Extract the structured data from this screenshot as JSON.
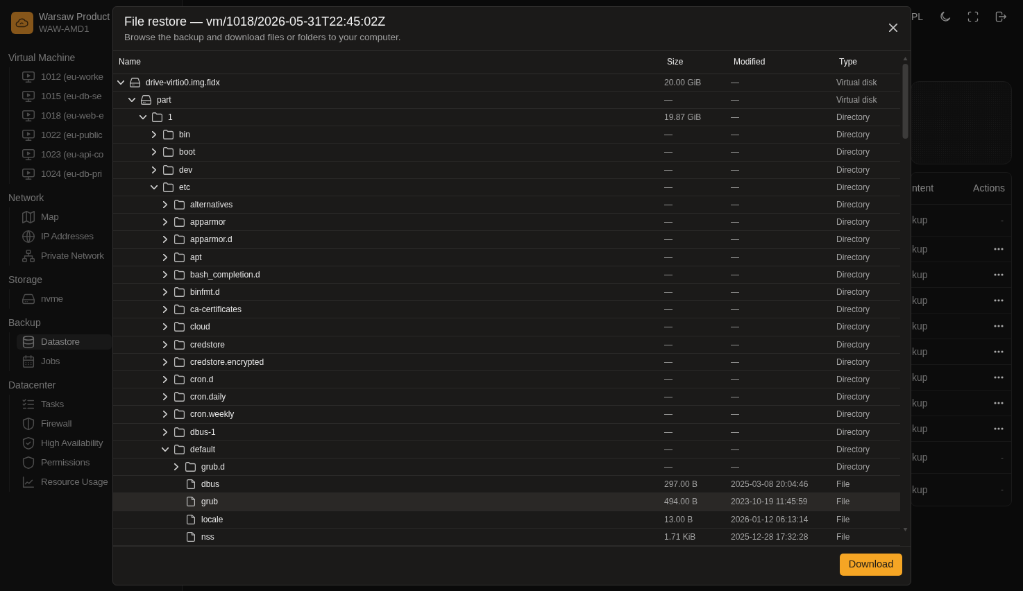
{
  "sidebar": {
    "brand": {
      "name": "Warsaw Product",
      "host": "WAW-AMD1"
    },
    "sections": [
      {
        "title": "Virtual Machine",
        "items": [
          {
            "label": "1012 (eu-worke",
            "selected": false
          },
          {
            "label": "1015 (eu-db-se",
            "selected": false
          },
          {
            "label": "1018 (eu-web-e",
            "selected": false
          },
          {
            "label": "1022 (eu-public",
            "selected": false
          },
          {
            "label": "1023 (eu-api-co",
            "selected": false
          },
          {
            "label": "1024 (eu-db-pri",
            "selected": false
          }
        ]
      },
      {
        "title": "Network",
        "items": [
          {
            "label": "Map",
            "selected": false
          },
          {
            "label": "IP Addresses",
            "selected": false
          },
          {
            "label": "Private Network",
            "selected": false
          }
        ]
      },
      {
        "title": "Storage",
        "items": [
          {
            "label": "nvme",
            "selected": false
          }
        ]
      },
      {
        "title": "Backup",
        "items": [
          {
            "label": "Datastore",
            "selected": true
          },
          {
            "label": "Jobs",
            "selected": false
          }
        ]
      },
      {
        "title": "Datacenter",
        "items": [
          {
            "label": "Tasks",
            "selected": false
          },
          {
            "label": "Firewall",
            "selected": false
          },
          {
            "label": "High Availability",
            "selected": false
          },
          {
            "label": "Permissions",
            "selected": false
          },
          {
            "label": "Resource Usage",
            "selected": false
          }
        ]
      }
    ]
  },
  "topbar": {
    "language": "PL"
  },
  "backups": {
    "columns": [
      "ntent",
      "Actions"
    ],
    "rows": [
      {
        "column_1": "kup",
        "kind": "text",
        "actions": "-"
      },
      {
        "column_1": "kup",
        "kind": "menu"
      },
      {
        "column_1": "kup",
        "kind": "menu"
      },
      {
        "column_1": "kup",
        "kind": "menu"
      },
      {
        "column_1": "kup",
        "kind": "menu"
      },
      {
        "column_1": "kup",
        "kind": "menu"
      },
      {
        "column_1": "kup",
        "kind": "menu"
      },
      {
        "column_1": "kup",
        "kind": "menu"
      },
      {
        "column_1": "kup",
        "kind": "menu"
      },
      {
        "column_1": "kup",
        "kind": "text",
        "actions": "-"
      },
      {
        "column_1": "kup",
        "kind": "text",
        "actions": "-"
      }
    ]
  },
  "dialog": {
    "title": "File restore — vm/1018/2026-05-31T22:45:02Z",
    "subtitle": "Browse the backup and download files or folders to your computer.",
    "columns": [
      "Name",
      "Size",
      "Modified",
      "Type"
    ],
    "tree": [
      {
        "name": "drive-virtio0.img.fidx",
        "kind": "disk",
        "expanded": true,
        "selected": false,
        "size": "20.00 GiB",
        "modified": "—",
        "type": "Virtual disk",
        "children": [
          {
            "name": "part",
            "kind": "disk",
            "expanded": true,
            "selected": false,
            "size": "—",
            "modified": "—",
            "type": "Virtual disk",
            "children": [
              {
                "name": "1",
                "kind": "folder",
                "expanded": true,
                "selected": false,
                "size": "19.87 GiB",
                "modified": "—",
                "type": "Directory",
                "children": [
                  {
                    "name": "bin",
                    "kind": "folder",
                    "expanded": false,
                    "selected": false,
                    "size": "—",
                    "modified": "—",
                    "type": "Directory"
                  },
                  {
                    "name": "boot",
                    "kind": "folder",
                    "expanded": false,
                    "selected": false,
                    "size": "—",
                    "modified": "—",
                    "type": "Directory"
                  },
                  {
                    "name": "dev",
                    "kind": "folder",
                    "expanded": false,
                    "selected": false,
                    "size": "—",
                    "modified": "—",
                    "type": "Directory"
                  },
                  {
                    "name": "etc",
                    "kind": "folder",
                    "expanded": true,
                    "selected": false,
                    "size": "—",
                    "modified": "—",
                    "type": "Directory",
                    "children": [
                      {
                        "name": "alternatives",
                        "kind": "folder",
                        "expanded": false,
                        "selected": false,
                        "size": "—",
                        "modified": "—",
                        "type": "Directory"
                      },
                      {
                        "name": "apparmor",
                        "kind": "folder",
                        "expanded": false,
                        "selected": false,
                        "size": "—",
                        "modified": "—",
                        "type": "Directory"
                      },
                      {
                        "name": "apparmor.d",
                        "kind": "folder",
                        "expanded": false,
                        "selected": false,
                        "size": "—",
                        "modified": "—",
                        "type": "Directory"
                      },
                      {
                        "name": "apt",
                        "kind": "folder",
                        "expanded": false,
                        "selected": false,
                        "size": "—",
                        "modified": "—",
                        "type": "Directory"
                      },
                      {
                        "name": "bash_completion.d",
                        "kind": "folder",
                        "expanded": false,
                        "selected": false,
                        "size": "—",
                        "modified": "—",
                        "type": "Directory"
                      },
                      {
                        "name": "binfmt.d",
                        "kind": "folder",
                        "expanded": false,
                        "selected": false,
                        "size": "—",
                        "modified": "—",
                        "type": "Directory"
                      },
                      {
                        "name": "ca-certificates",
                        "kind": "folder",
                        "expanded": false,
                        "selected": false,
                        "size": "—",
                        "modified": "—",
                        "type": "Directory"
                      },
                      {
                        "name": "cloud",
                        "kind": "folder",
                        "expanded": false,
                        "selected": false,
                        "size": "—",
                        "modified": "—",
                        "type": "Directory"
                      },
                      {
                        "name": "credstore",
                        "kind": "folder",
                        "expanded": false,
                        "selected": false,
                        "size": "—",
                        "modified": "—",
                        "type": "Directory"
                      },
                      {
                        "name": "credstore.encrypted",
                        "kind": "folder",
                        "expanded": false,
                        "selected": false,
                        "size": "—",
                        "modified": "—",
                        "type": "Directory"
                      },
                      {
                        "name": "cron.d",
                        "kind": "folder",
                        "expanded": false,
                        "selected": false,
                        "size": "—",
                        "modified": "—",
                        "type": "Directory"
                      },
                      {
                        "name": "cron.daily",
                        "kind": "folder",
                        "expanded": false,
                        "selected": false,
                        "size": "—",
                        "modified": "—",
                        "type": "Directory"
                      },
                      {
                        "name": "cron.weekly",
                        "kind": "folder",
                        "expanded": false,
                        "selected": false,
                        "size": "—",
                        "modified": "—",
                        "type": "Directory"
                      },
                      {
                        "name": "dbus-1",
                        "kind": "folder",
                        "expanded": false,
                        "selected": false,
                        "size": "—",
                        "modified": "—",
                        "type": "Directory"
                      },
                      {
                        "name": "default",
                        "kind": "folder",
                        "expanded": true,
                        "selected": false,
                        "size": "—",
                        "modified": "—",
                        "type": "Directory",
                        "children": [
                          {
                            "name": "grub.d",
                            "kind": "folder",
                            "expanded": false,
                            "selected": false,
                            "size": "—",
                            "modified": "—",
                            "type": "Directory"
                          },
                          {
                            "name": "dbus",
                            "kind": "file",
                            "selected": false,
                            "size": "297.00 B",
                            "modified": "2025-03-08 20:04:46",
                            "type": "File"
                          },
                          {
                            "name": "grub",
                            "kind": "file",
                            "selected": true,
                            "size": "494.00 B",
                            "modified": "2023-10-19 11:45:59",
                            "type": "File"
                          },
                          {
                            "name": "locale",
                            "kind": "file",
                            "selected": false,
                            "size": "13.00 B",
                            "modified": "2026-01-12 06:13:14",
                            "type": "File"
                          },
                          {
                            "name": "nss",
                            "kind": "file",
                            "selected": false,
                            "size": "1.71 KiB",
                            "modified": "2025-12-28 17:32:28",
                            "type": "File"
                          }
                        ]
                      }
                    ]
                  }
                ]
              }
            ]
          }
        ]
      }
    ],
    "download_button": "Download"
  }
}
